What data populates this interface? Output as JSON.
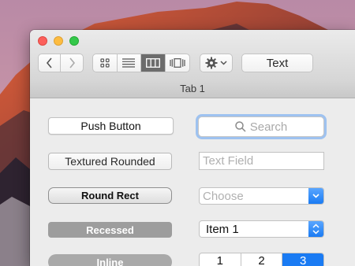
{
  "window": {
    "tab_title": "Tab 1"
  },
  "toolbar": {
    "back_icon": "chevron-left-icon",
    "forward_icon": "chevron-right-icon",
    "view_modes": [
      "icon-view-icon",
      "list-view-icon",
      "column-view-icon",
      "cover-flow-view-icon"
    ],
    "selected_view_mode": "column-view-icon",
    "action_icon": "gear-icon",
    "text_button_label": "Text"
  },
  "controls": {
    "push_button": "Push Button",
    "textured_rounded": "Textured Rounded",
    "round_rect": "Round Rect",
    "recessed": "Recessed",
    "inline": "Inline",
    "search_placeholder": "Search",
    "text_field_placeholder": "Text Field",
    "combo_placeholder": "Choose",
    "popup_selected": "Item 1",
    "segments": [
      "1",
      "2",
      "3"
    ],
    "selected_segment": "3"
  },
  "colors": {
    "accent": "#1a7bf3",
    "close": "#fc605b",
    "minimize": "#fdbc40",
    "zoom": "#34c84a"
  }
}
